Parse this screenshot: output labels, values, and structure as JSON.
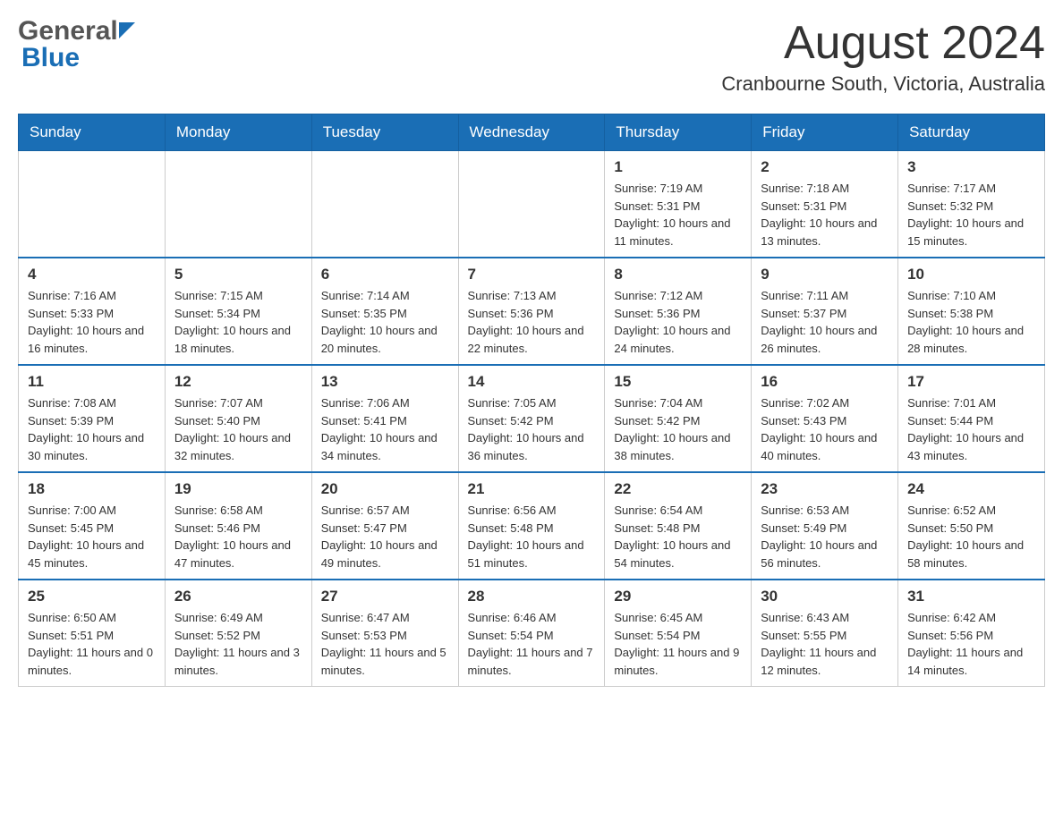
{
  "logo": {
    "general": "General",
    "blue": "Blue"
  },
  "title": {
    "month_year": "August 2024",
    "location": "Cranbourne South, Victoria, Australia"
  },
  "days_of_week": [
    "Sunday",
    "Monday",
    "Tuesday",
    "Wednesday",
    "Thursday",
    "Friday",
    "Saturday"
  ],
  "weeks": [
    {
      "days": [
        {
          "number": "",
          "info": ""
        },
        {
          "number": "",
          "info": ""
        },
        {
          "number": "",
          "info": ""
        },
        {
          "number": "",
          "info": ""
        },
        {
          "number": "1",
          "info": "Sunrise: 7:19 AM\nSunset: 5:31 PM\nDaylight: 10 hours and 11 minutes."
        },
        {
          "number": "2",
          "info": "Sunrise: 7:18 AM\nSunset: 5:31 PM\nDaylight: 10 hours and 13 minutes."
        },
        {
          "number": "3",
          "info": "Sunrise: 7:17 AM\nSunset: 5:32 PM\nDaylight: 10 hours and 15 minutes."
        }
      ]
    },
    {
      "days": [
        {
          "number": "4",
          "info": "Sunrise: 7:16 AM\nSunset: 5:33 PM\nDaylight: 10 hours and 16 minutes."
        },
        {
          "number": "5",
          "info": "Sunrise: 7:15 AM\nSunset: 5:34 PM\nDaylight: 10 hours and 18 minutes."
        },
        {
          "number": "6",
          "info": "Sunrise: 7:14 AM\nSunset: 5:35 PM\nDaylight: 10 hours and 20 minutes."
        },
        {
          "number": "7",
          "info": "Sunrise: 7:13 AM\nSunset: 5:36 PM\nDaylight: 10 hours and 22 minutes."
        },
        {
          "number": "8",
          "info": "Sunrise: 7:12 AM\nSunset: 5:36 PM\nDaylight: 10 hours and 24 minutes."
        },
        {
          "number": "9",
          "info": "Sunrise: 7:11 AM\nSunset: 5:37 PM\nDaylight: 10 hours and 26 minutes."
        },
        {
          "number": "10",
          "info": "Sunrise: 7:10 AM\nSunset: 5:38 PM\nDaylight: 10 hours and 28 minutes."
        }
      ]
    },
    {
      "days": [
        {
          "number": "11",
          "info": "Sunrise: 7:08 AM\nSunset: 5:39 PM\nDaylight: 10 hours and 30 minutes."
        },
        {
          "number": "12",
          "info": "Sunrise: 7:07 AM\nSunset: 5:40 PM\nDaylight: 10 hours and 32 minutes."
        },
        {
          "number": "13",
          "info": "Sunrise: 7:06 AM\nSunset: 5:41 PM\nDaylight: 10 hours and 34 minutes."
        },
        {
          "number": "14",
          "info": "Sunrise: 7:05 AM\nSunset: 5:42 PM\nDaylight: 10 hours and 36 minutes."
        },
        {
          "number": "15",
          "info": "Sunrise: 7:04 AM\nSunset: 5:42 PM\nDaylight: 10 hours and 38 minutes."
        },
        {
          "number": "16",
          "info": "Sunrise: 7:02 AM\nSunset: 5:43 PM\nDaylight: 10 hours and 40 minutes."
        },
        {
          "number": "17",
          "info": "Sunrise: 7:01 AM\nSunset: 5:44 PM\nDaylight: 10 hours and 43 minutes."
        }
      ]
    },
    {
      "days": [
        {
          "number": "18",
          "info": "Sunrise: 7:00 AM\nSunset: 5:45 PM\nDaylight: 10 hours and 45 minutes."
        },
        {
          "number": "19",
          "info": "Sunrise: 6:58 AM\nSunset: 5:46 PM\nDaylight: 10 hours and 47 minutes."
        },
        {
          "number": "20",
          "info": "Sunrise: 6:57 AM\nSunset: 5:47 PM\nDaylight: 10 hours and 49 minutes."
        },
        {
          "number": "21",
          "info": "Sunrise: 6:56 AM\nSunset: 5:48 PM\nDaylight: 10 hours and 51 minutes."
        },
        {
          "number": "22",
          "info": "Sunrise: 6:54 AM\nSunset: 5:48 PM\nDaylight: 10 hours and 54 minutes."
        },
        {
          "number": "23",
          "info": "Sunrise: 6:53 AM\nSunset: 5:49 PM\nDaylight: 10 hours and 56 minutes."
        },
        {
          "number": "24",
          "info": "Sunrise: 6:52 AM\nSunset: 5:50 PM\nDaylight: 10 hours and 58 minutes."
        }
      ]
    },
    {
      "days": [
        {
          "number": "25",
          "info": "Sunrise: 6:50 AM\nSunset: 5:51 PM\nDaylight: 11 hours and 0 minutes."
        },
        {
          "number": "26",
          "info": "Sunrise: 6:49 AM\nSunset: 5:52 PM\nDaylight: 11 hours and 3 minutes."
        },
        {
          "number": "27",
          "info": "Sunrise: 6:47 AM\nSunset: 5:53 PM\nDaylight: 11 hours and 5 minutes."
        },
        {
          "number": "28",
          "info": "Sunrise: 6:46 AM\nSunset: 5:54 PM\nDaylight: 11 hours and 7 minutes."
        },
        {
          "number": "29",
          "info": "Sunrise: 6:45 AM\nSunset: 5:54 PM\nDaylight: 11 hours and 9 minutes."
        },
        {
          "number": "30",
          "info": "Sunrise: 6:43 AM\nSunset: 5:55 PM\nDaylight: 11 hours and 12 minutes."
        },
        {
          "number": "31",
          "info": "Sunrise: 6:42 AM\nSunset: 5:56 PM\nDaylight: 11 hours and 14 minutes."
        }
      ]
    }
  ]
}
